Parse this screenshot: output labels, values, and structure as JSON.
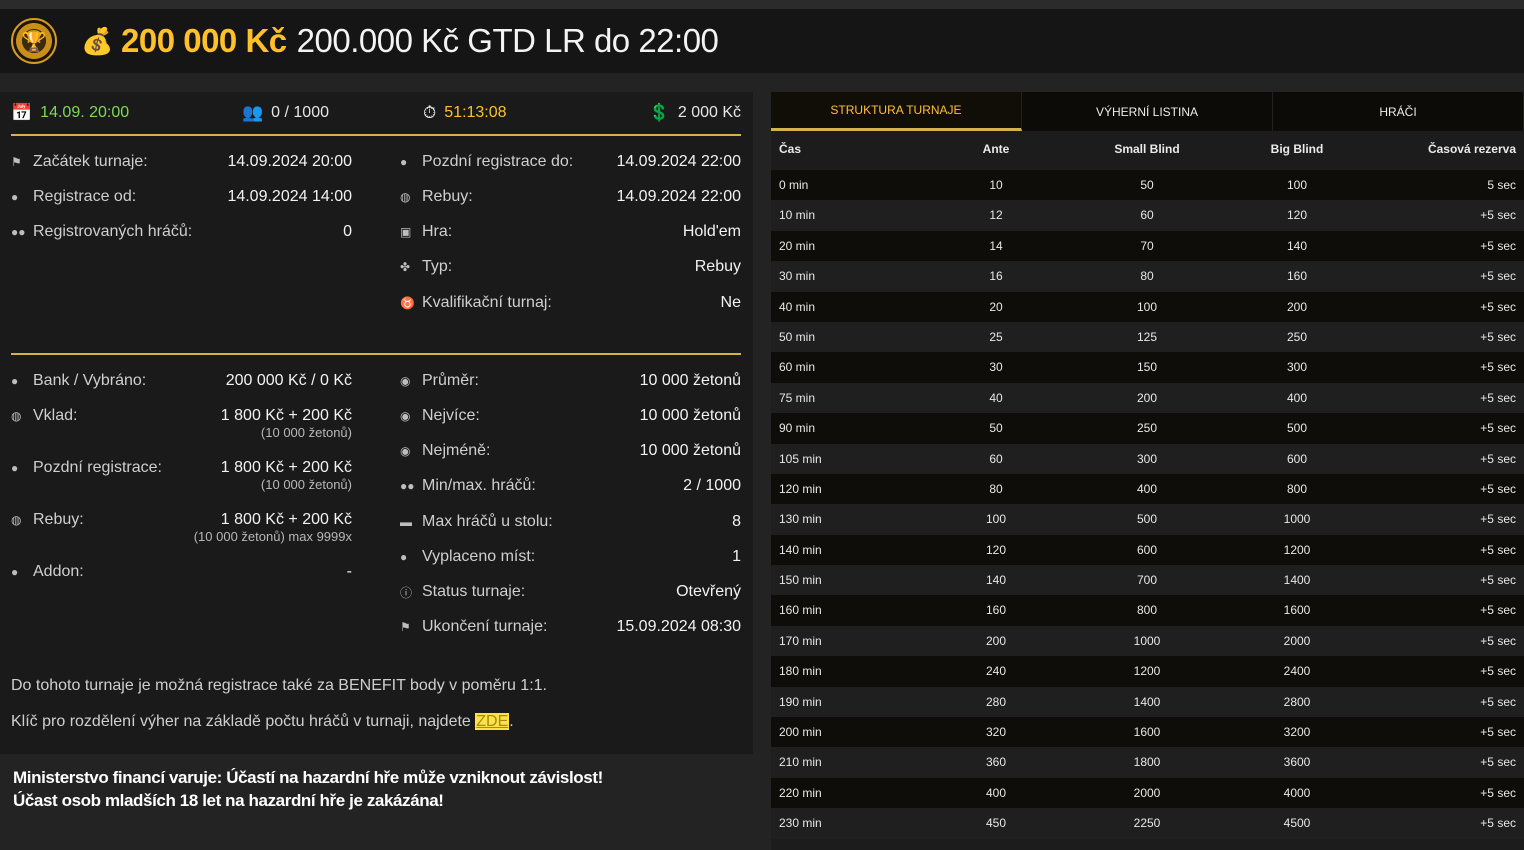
{
  "header": {
    "amount": "200 000 Kč",
    "title": "200.000 Kč GTD LR do 22:00"
  },
  "stats": {
    "date": "14.09. 20:00",
    "players": "0 / 1000",
    "timer": "51:13:08",
    "buyin": "2 000 Kč"
  },
  "info_left": [
    {
      "label": "Začátek turnaje:",
      "value": "14.09.2024 20:00",
      "icon": "flag-icon"
    },
    {
      "label": "Registrace od:",
      "value": "14.09.2024 14:00",
      "icon": "user-icon"
    },
    {
      "label": "Registrovaných hráčů:",
      "value": "0",
      "icon": "users-icon"
    }
  ],
  "info_right": [
    {
      "label": "Pozdní registrace do:",
      "value": "14.09.2024 22:00",
      "icon": "user-icon"
    },
    {
      "label": "Rebuy:",
      "value": "14.09.2024 22:00",
      "icon": "money-icon"
    },
    {
      "label": "Hra:",
      "value": "Hold'em",
      "icon": "cards-icon"
    },
    {
      "label": "Typ:",
      "value": "Rebuy",
      "icon": "type-icon"
    },
    {
      "label": "Kvalifikační turnaj:",
      "value": "Ne",
      "icon": "medal-icon"
    }
  ],
  "money_left": [
    {
      "label": "Bank / Vybráno:",
      "value": "200 000 Kč / 0 Kč",
      "sub": "",
      "icon": "bag-icon"
    },
    {
      "label": "Vklad:",
      "value": "1 800 Kč + 200 Kč",
      "sub": "(10 000 žetonů)",
      "icon": "money-icon"
    },
    {
      "label": "Pozdní registrace:",
      "value": "1 800 Kč + 200 Kč",
      "sub": "(10 000 žetonů)",
      "icon": "coin-icon"
    },
    {
      "label": "Rebuy:",
      "value": "1 800 Kč + 200 Kč",
      "sub": "(10 000 žetonů) max 9999x",
      "icon": "money-icon"
    },
    {
      "label": "Addon:",
      "value": "-",
      "sub": "",
      "icon": "coin-icon"
    }
  ],
  "money_right": [
    {
      "label": "Průměr:",
      "value": "10 000 žetonů",
      "icon": "chip-icon"
    },
    {
      "label": "Nejvíce:",
      "value": "10 000 žetonů",
      "icon": "chip-icon"
    },
    {
      "label": "Nejméně:",
      "value": "10 000 žetonů",
      "icon": "chip-icon"
    },
    {
      "label": "Min/max. hráčů:",
      "value": "2 / 1000",
      "icon": "users-icon"
    },
    {
      "label": "Max hráčů u stolu:",
      "value": "8",
      "icon": "table-icon"
    },
    {
      "label": "Vyplaceno míst:",
      "value": "1",
      "icon": "payout-icon"
    },
    {
      "label": "Status turnaje:",
      "value": "Otevřený",
      "icon": "info-icon"
    },
    {
      "label": "Ukončení turnaje:",
      "value": "15.09.2024 08:30",
      "icon": "flag-icon"
    }
  ],
  "notes": {
    "benefit": "Do tohoto turnaje je možná registrace také za BENEFIT body v poměru 1:1.",
    "key_prefix": "Klíč pro rozdělení výher na základě počtu hráčů v turnaji, najdete ",
    "key_link": "ZDE",
    "key_suffix": "."
  },
  "warning": {
    "line1": "Ministerstvo financí varuje: Účastí na hazardní hře může vzniknout závislost!",
    "line2": "Účast osob mladších 18 let na hazardní hře je zakázána!"
  },
  "tabs": [
    "STRUKTURA TURNAJE",
    "VÝHERNÍ LISTINA",
    "HRÁČI"
  ],
  "table": {
    "headers": [
      "Čas",
      "Ante",
      "Small Blind",
      "Big Blind",
      "Časová rezerva"
    ],
    "rows": [
      [
        "0 min",
        "10",
        "50",
        "100",
        "5 sec"
      ],
      [
        "10 min",
        "12",
        "60",
        "120",
        "+5 sec"
      ],
      [
        "20 min",
        "14",
        "70",
        "140",
        "+5 sec"
      ],
      [
        "30 min",
        "16",
        "80",
        "160",
        "+5 sec"
      ],
      [
        "40 min",
        "20",
        "100",
        "200",
        "+5 sec"
      ],
      [
        "50 min",
        "25",
        "125",
        "250",
        "+5 sec"
      ],
      [
        "60 min",
        "30",
        "150",
        "300",
        "+5 sec"
      ],
      [
        "75 min",
        "40",
        "200",
        "400",
        "+5 sec"
      ],
      [
        "90 min",
        "50",
        "250",
        "500",
        "+5 sec"
      ],
      [
        "105 min",
        "60",
        "300",
        "600",
        "+5 sec"
      ],
      [
        "120 min",
        "80",
        "400",
        "800",
        "+5 sec"
      ],
      [
        "130 min",
        "100",
        "500",
        "1000",
        "+5 sec"
      ],
      [
        "140 min",
        "120",
        "600",
        "1200",
        "+5 sec"
      ],
      [
        "150 min",
        "140",
        "700",
        "1400",
        "+5 sec"
      ],
      [
        "160 min",
        "160",
        "800",
        "1600",
        "+5 sec"
      ],
      [
        "170 min",
        "200",
        "1000",
        "2000",
        "+5 sec"
      ],
      [
        "180 min",
        "240",
        "1200",
        "2400",
        "+5 sec"
      ],
      [
        "190 min",
        "280",
        "1400",
        "2800",
        "+5 sec"
      ],
      [
        "200 min",
        "320",
        "1600",
        "3200",
        "+5 sec"
      ],
      [
        "210 min",
        "360",
        "1800",
        "3600",
        "+5 sec"
      ],
      [
        "220 min",
        "400",
        "2000",
        "4000",
        "+5 sec"
      ],
      [
        "230 min",
        "450",
        "2250",
        "4500",
        "+5 sec"
      ]
    ]
  }
}
